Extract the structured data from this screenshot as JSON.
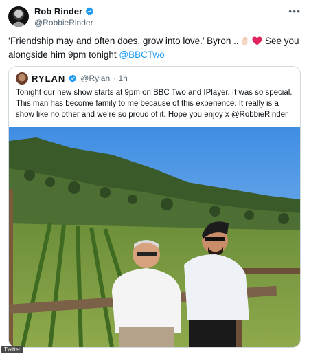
{
  "author": {
    "name": "Rob Rinder",
    "handle": "@RobbieRinder",
    "verified_color": "#1d9bf0"
  },
  "menu_icon": "more-horizontal-icon",
  "tweet": {
    "text_part1": "‘Friendship may and often does, grow into love.’ Byron ..",
    "text_part2": " See you alongside him 9pm tonight ",
    "mention": "@BBCTwo",
    "emojis": [
      "raised-hand-emoji",
      "red-heart-emoji"
    ]
  },
  "quoted": {
    "name": "RYLAN",
    "handle": "@Rylan",
    "time": "· 1h",
    "text": "Tonight our new show starts at 9pm on BBC Two and IPlayer. It was so special. This man has become family to me because of this experience. It really is a show like no other and we’re so proud of it. Hope you enjoy x @RobbieRinder",
    "image_alt": "photo-two-men-leaning-on-fence-in-vineyard"
  },
  "source_label": "Twitter",
  "colors": {
    "link": "#1d9bf0",
    "text": "#0f1419",
    "secondary": "#536471",
    "border": "#cfd9de"
  }
}
